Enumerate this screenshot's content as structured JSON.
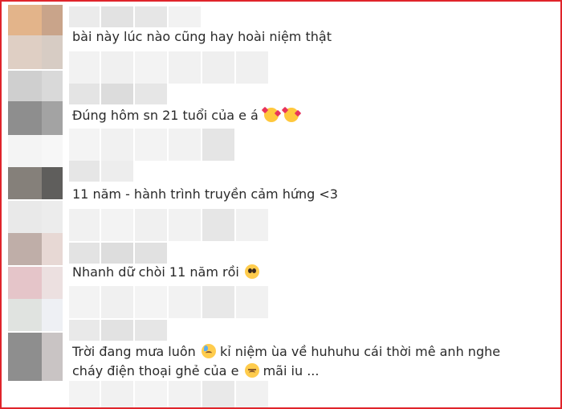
{
  "comments": [
    {
      "line1": "bài này lúc nào cũng hay hoài niệm thật"
    },
    {
      "line1": "Đúng hôm sn 21 tuổi của e á",
      "emoji": [
        "smiling-face-with-hearts-icon",
        "smiling-face-with-hearts-icon"
      ]
    },
    {
      "line1": "11 năm - hành trình truyền cảm hứng <3"
    },
    {
      "line1": "Nhanh dữ chòi 11 năm rồi",
      "emoji": [
        "pleading-face-icon"
      ]
    },
    {
      "line1_a": "Trời đang mưa luôn",
      "line1_b": "kỉ niệm ùa về huhuhu cái thời mê anh nghe",
      "line2_a": "cháy điện thoại ghẻ của e",
      "line2_b": "mãi iu ...",
      "emoji": [
        "sad-but-relieved-face-icon",
        "disappointed-face-icon"
      ]
    }
  ],
  "colors": {
    "frame_border": "#e0242b",
    "text": "#2a2a2a"
  }
}
